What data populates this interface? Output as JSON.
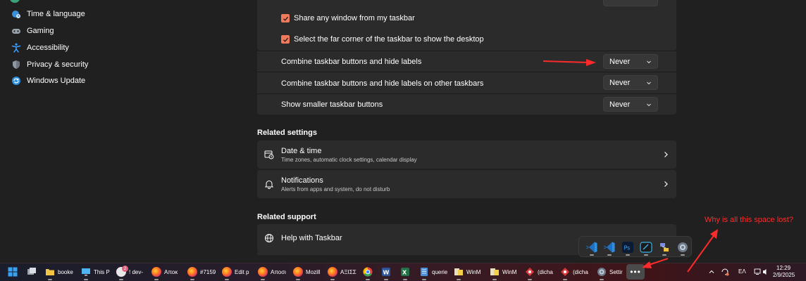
{
  "sidebar": {
    "items": [
      {
        "label": "Time & language",
        "icon": "globe-clock-icon"
      },
      {
        "label": "Gaming",
        "icon": "gamepad-icon"
      },
      {
        "label": "Accessibility",
        "icon": "accessibility-icon"
      },
      {
        "label": "Privacy & security",
        "icon": "shield-icon"
      },
      {
        "label": "Windows Update",
        "icon": "update-icon"
      }
    ]
  },
  "behaviors": {
    "checkboxes": [
      {
        "label": "Share any window from my taskbar",
        "checked": true
      },
      {
        "label": "Select the far corner of the taskbar to show the desktop",
        "checked": true
      }
    ],
    "dropdown_rows": [
      {
        "label": "Combine taskbar buttons and hide labels",
        "value": "Never"
      },
      {
        "label": "Combine taskbar buttons and hide labels on other taskbars",
        "value": "Never"
      },
      {
        "label": "Show smaller taskbar buttons",
        "value": "Never"
      }
    ]
  },
  "related_settings": {
    "title": "Related settings",
    "cards": [
      {
        "title": "Date & time",
        "subtitle": "Time zones, automatic clock settings, calendar display",
        "icon": "calendar-clock-icon"
      },
      {
        "title": "Notifications",
        "subtitle": "Alerts from apps and system, do not disturb",
        "icon": "bell-icon"
      }
    ]
  },
  "related_support": {
    "title": "Related support",
    "cards": [
      {
        "title": "Help with Taskbar",
        "icon": "globe-icon"
      }
    ]
  },
  "annotation": {
    "text": "Why is all this space lost?",
    "color": "#ff2a2a"
  },
  "accent_color": "#f07a5a",
  "taskbar": {
    "items": [
      {
        "label": "booke",
        "icon": "folder-icon"
      },
      {
        "label": "This P",
        "icon": "computer-icon"
      },
      {
        "label": "! dev-",
        "icon": "app-badge-icon",
        "badge": "2"
      },
      {
        "label": "Αποκ",
        "icon": "firefox-icon"
      },
      {
        "label": "#7159",
        "icon": "firefox-icon"
      },
      {
        "label": "Edit p",
        "icon": "firefox-icon"
      },
      {
        "label": "Αποσι",
        "icon": "firefox-icon"
      },
      {
        "label": "Mozill",
        "icon": "firefox-icon"
      },
      {
        "label": "ΑΞΙΣΣ",
        "icon": "firefox-icon"
      },
      {
        "label": "querie",
        "icon": "document-icon"
      },
      {
        "label": "WinM",
        "icon": "winmerge-icon"
      },
      {
        "label": "WinM",
        "icon": "winmerge-icon"
      },
      {
        "label": "(dicha",
        "icon": "tool-icon"
      },
      {
        "label": "(dicha",
        "icon": "tool-icon"
      },
      {
        "label": "Settir",
        "icon": "gear-icon"
      }
    ],
    "more_label": "•••",
    "tray": {
      "language": "ΕΛ",
      "time": "12:29",
      "date": "2/9/2025"
    }
  }
}
